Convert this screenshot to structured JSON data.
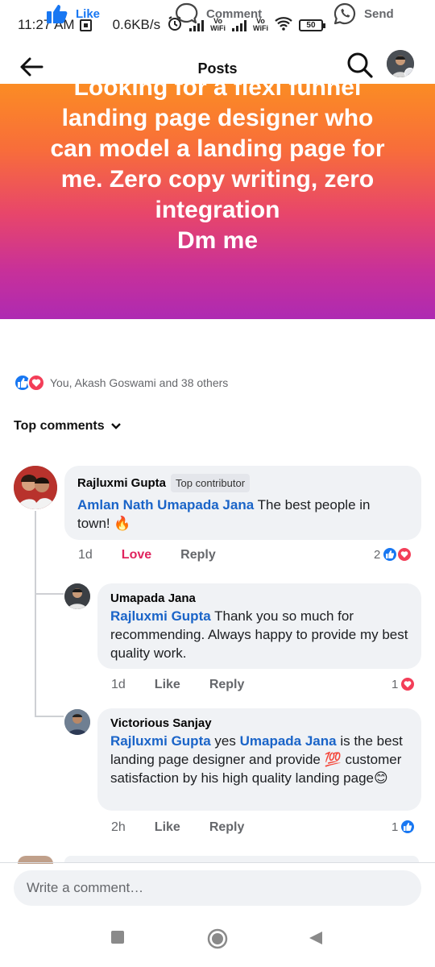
{
  "status_bar": {
    "time": "11:27 AM",
    "speed": "0.6KB/s",
    "vo1": "Vo",
    "wifi1": "WiFi",
    "vo2": "Vo",
    "wifi2": "WiFi",
    "battery": "50"
  },
  "header": {
    "title": "Posts"
  },
  "banner": {
    "text": "Looking for a flexi funnel\nlanding page designer who\ncan model a landing page for\nme. Zero copy writing, zero\nintegration\nDm me"
  },
  "actions": {
    "like": "Like",
    "comment": "Comment",
    "send": "Send"
  },
  "reactions": {
    "summary": "You, Akash Goswami and 38 others"
  },
  "top_comments_label": "Top comments",
  "comments": [
    {
      "author": "Rajluxmi Gupta",
      "badge": "Top contributor",
      "mention": "Amlan Nath Umapada Jana",
      "text_line1": " The best people in",
      "text_line2": "town! 🔥",
      "time": "1d",
      "reaction_label": "Love",
      "reply": "Reply",
      "count": "2"
    },
    {
      "author": "Umapada Jana",
      "mention": "Rajluxmi Gupta",
      "text": " Thank you so much for recommending. Always happy to provide my best quality work.",
      "time": "1d",
      "like": "Like",
      "reply": "Reply",
      "count": "1"
    },
    {
      "author": "Victorious Sanjay",
      "mention1": "Rajluxmi Gupta",
      "text1": " yes ",
      "mention2": "Umapada Jana",
      "text2": " is the best landing page designer and provide 💯 customer satisfaction by his high quality landing page😊",
      "time": "2h",
      "like": "Like",
      "reply": "Reply",
      "count": "1"
    }
  ],
  "composer": {
    "placeholder": "Write a comment…"
  },
  "colors": {
    "facebook_blue": "#1877f2",
    "love_red": "#f33e58",
    "mention_blue": "#1a64c8"
  }
}
